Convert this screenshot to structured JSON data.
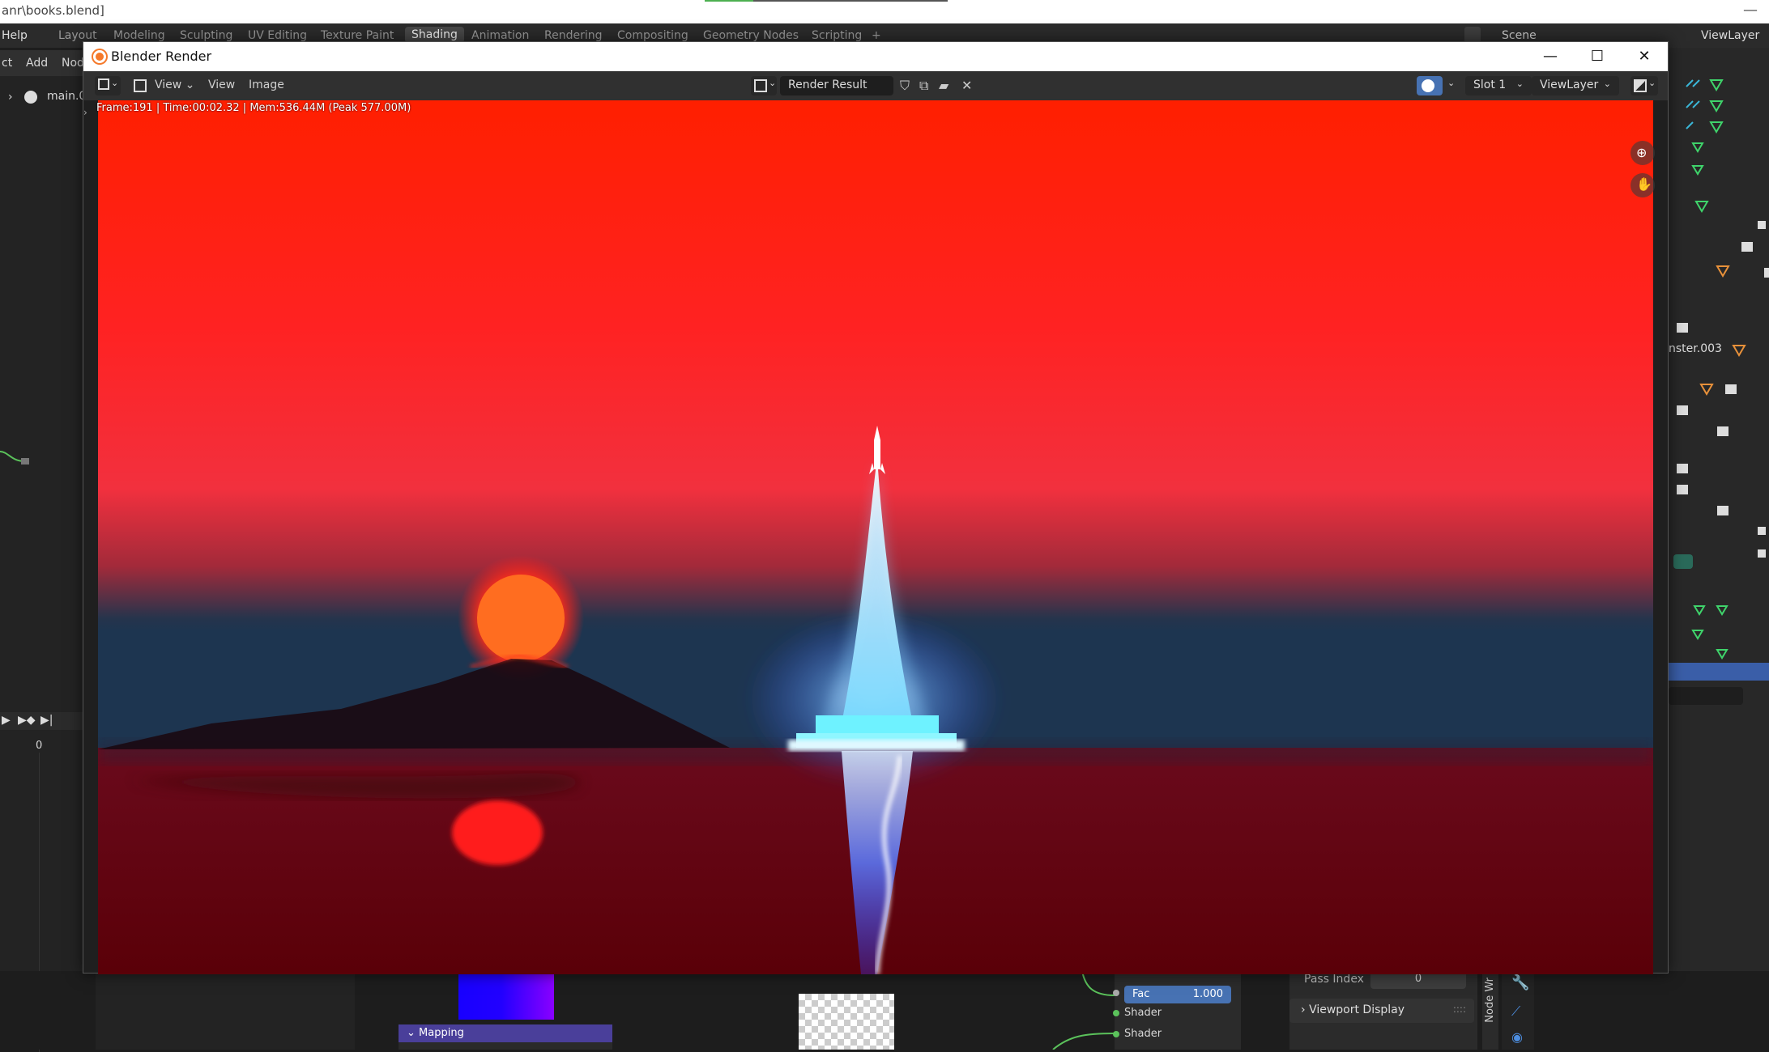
{
  "background": {
    "title": "anr\\books.blend]",
    "workspaces": [
      "Layout",
      "Modeling",
      "Sculpting",
      "UV Editing",
      "Texture Paint",
      "Shading",
      "Animation",
      "Rendering",
      "Compositing",
      "Geometry Nodes",
      "Scripting",
      "+"
    ],
    "active_workspace": "Shading",
    "menu": {
      "help": "Help",
      "select": "ct",
      "add": "Add",
      "node": "Nod"
    },
    "scene_label": "Scene",
    "viewlayer_label": "ViewLayer",
    "outliner_item": "main.0",
    "object_label": "nster.003",
    "frame_value": "0",
    "node_fac_label": "Fac",
    "node_fac_value": "1.000",
    "node_shader_1": "Shader",
    "node_shader_2": "Shader",
    "node_mapping": "Mapping",
    "pass_index_label": "Pass Index",
    "pass_index_value": "0",
    "viewport_display": "Viewport Display",
    "node_wrangler": "Node Wr"
  },
  "render_window": {
    "title": "Blender Render",
    "menu_view_1": "View",
    "menu_view_2": "View",
    "menu_image": "Image",
    "image_name": "Render Result",
    "slot": "Slot 1",
    "viewlayer": "ViewLayer",
    "stats": "Frame:191 | Time:00:02.32 | Mem:536.44M (Peak 577.00M)"
  },
  "colors": {
    "sky_top": "#ff1e00",
    "sky_mid": "#ff2a3a",
    "sea": "#6a0412",
    "sun": "#ff6d1e",
    "rocket_glow": "#9fd6ff"
  }
}
